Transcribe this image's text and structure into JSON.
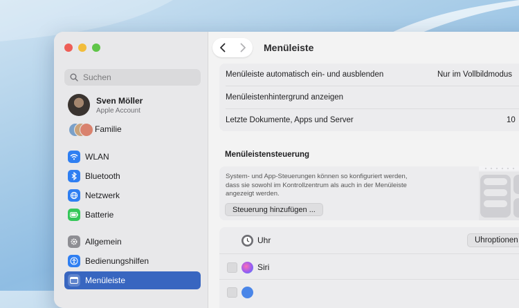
{
  "window": {
    "title": "Menüleiste"
  },
  "search": {
    "placeholder": "Suchen"
  },
  "account": {
    "name": "Sven Möller",
    "subtitle": "Apple Account"
  },
  "family": {
    "label": "Familie"
  },
  "sidebar": {
    "items": [
      {
        "label": "WLAN",
        "icon": "wifi-icon",
        "color": "#2f7ff2"
      },
      {
        "label": "Bluetooth",
        "icon": "bluetooth-icon",
        "color": "#2f7ff2"
      },
      {
        "label": "Netzwerk",
        "icon": "globe-icon",
        "color": "#2f7ff2"
      },
      {
        "label": "Batterie",
        "icon": "battery-icon",
        "color": "#35c759"
      },
      {
        "label": "Allgemein",
        "icon": "gear-icon",
        "color": "#8e8e93"
      },
      {
        "label": "Bedienungshilfen",
        "icon": "accessibility-icon",
        "color": "#2f7ff2"
      },
      {
        "label": "Menüleiste",
        "icon": "menubar-icon",
        "color": "#ffffff",
        "selected": true
      }
    ]
  },
  "settings": {
    "rows": [
      {
        "label": "Menüleiste automatisch ein- und ausblenden",
        "value": "Nur im Vollbildmodus"
      },
      {
        "label": "Menüleistenhintergrund anzeigen",
        "toggle": true
      },
      {
        "label": "Letzte Dokumente, Apps und Server",
        "value": "10"
      }
    ]
  },
  "controls_section": {
    "heading": "Menüleistensteuerung",
    "description": "System- und App-Steuerungen können so konfiguriert werden, dass sie sowohl im Kontrollzentrum als auch in der Menüleiste angezeigt werden.",
    "add_button": "Steuerung hinzufügen ...",
    "items": [
      {
        "label": "Uhr",
        "icon": "clock-icon",
        "option_button": "Uhroptionen"
      },
      {
        "label": "Siri",
        "icon": "siri-icon"
      }
    ]
  },
  "colors": {
    "accent": "#3866c0",
    "toggle_on": "#3c6fd0"
  }
}
